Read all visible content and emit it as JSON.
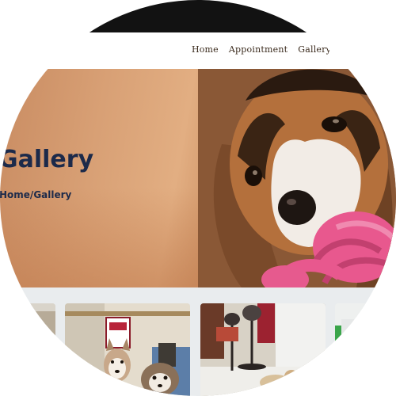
{
  "nav": {
    "links": [
      {
        "label": "Home"
      },
      {
        "label": "Appointment"
      },
      {
        "label": "Gallery"
      }
    ]
  },
  "hero": {
    "title": "Gallery",
    "breadcrumb": "Home/Gallery"
  },
  "colors": {
    "topbar": "#121212",
    "heading_navy": "#1c2a4a",
    "toy_pink": "#e8588e",
    "strip_bg": "#e9ecee"
  },
  "gallery": {
    "items": [
      {
        "name": "gallery-photo-partial-left"
      },
      {
        "name": "gallery-photo-husky-and-shih-tzu"
      },
      {
        "name": "gallery-photo-salon-dryers"
      },
      {
        "name": "gallery-photo-partial-right"
      }
    ]
  }
}
